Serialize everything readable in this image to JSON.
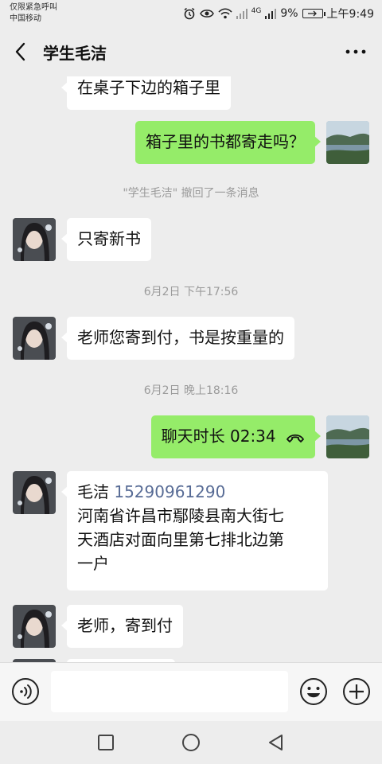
{
  "status_bar": {
    "emergency": "仅限紧急呼叫",
    "carrier": "中国移动",
    "network": "4G",
    "battery": "9%",
    "time": "上午9:49"
  },
  "header": {
    "title": "学生毛洁",
    "back_icon": "chevron-left-icon",
    "more_icon": "ellipsis-icon"
  },
  "messages": [
    {
      "side": "left",
      "text": "在桌子下边的箱子里"
    },
    {
      "side": "right",
      "text": "箱子里的书都寄走吗？"
    },
    {
      "type": "system",
      "text": "\"学生毛洁\" 撤回了一条消息"
    },
    {
      "side": "left",
      "text": "只寄新书"
    },
    {
      "type": "time",
      "text": "6月2日 下午17:56"
    },
    {
      "side": "left",
      "text": "老师您寄到付，书是按重量的"
    },
    {
      "type": "time",
      "text": "6月2日 晚上18:16"
    },
    {
      "side": "right",
      "text": "聊天时长 02:34",
      "icon": "phone-hangup-icon"
    },
    {
      "side": "left",
      "name": "毛洁",
      "phone": "15290961290",
      "address_lines": [
        "河南省许昌市鄢陵县南大街七",
        "天酒店对面向里第七排北边第",
        "一户"
      ]
    },
    {
      "side": "left",
      "text": "老师，寄到付"
    }
  ],
  "input_bar": {
    "placeholder": "",
    "voice_icon": "voice-icon",
    "emoji_icon": "emoji-icon",
    "plus_icon": "plus-icon"
  },
  "nav_bar": {
    "icons": [
      "recent-apps-icon",
      "home-icon",
      "back-triangle-icon"
    ]
  }
}
